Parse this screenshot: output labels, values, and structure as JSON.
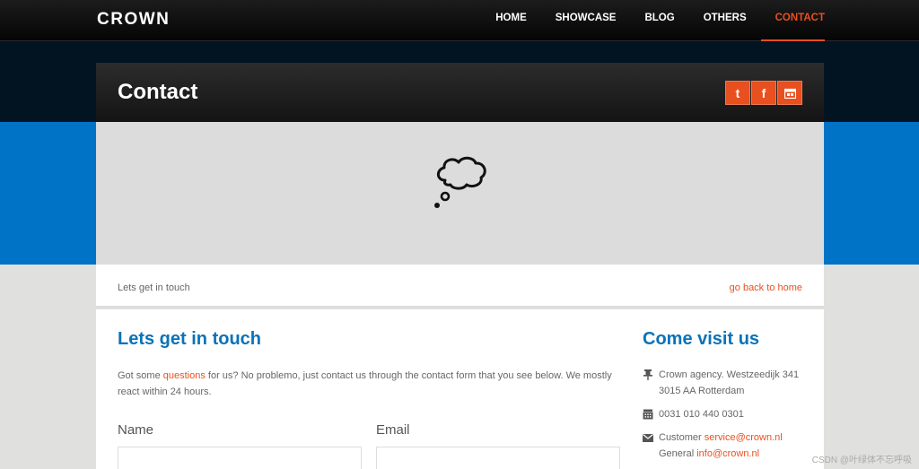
{
  "header": {
    "logo": "CROWN",
    "nav": [
      {
        "label": "HOME"
      },
      {
        "label": "SHOWCASE"
      },
      {
        "label": "BLOG"
      },
      {
        "label": "OTHERS"
      },
      {
        "label": "CONTACT",
        "active": true
      }
    ]
  },
  "title_bar": {
    "title": "Contact",
    "social": [
      {
        "icon": "twitter-icon",
        "glyph": "t"
      },
      {
        "icon": "facebook-icon",
        "glyph": "f"
      },
      {
        "icon": "calendar-icon",
        "glyph": "▣"
      }
    ]
  },
  "hero": {
    "icon": "thought-bubble-icon"
  },
  "breadcrumb": {
    "current": "Lets get in touch",
    "back_link": "go back to home"
  },
  "contact": {
    "heading": "Lets get in touch",
    "intro_before": "Got some ",
    "intro_link": "questions",
    "intro_after": " for us? No problemo, just contact us through the contact form that you see below. We mostly react within 24 hours.",
    "name_label": "Name",
    "email_label": "Email"
  },
  "visit": {
    "heading": "Come visit us",
    "address_line1": "Crown agency. Westzeedijk 341",
    "address_line2": "3015 AA Rotterdam",
    "phone": "0031 010 440 0301",
    "customer_label": "Customer ",
    "customer_email": "service@crown.nl",
    "general_label": "General ",
    "general_email": "info@crown.nl"
  },
  "watermark": "CSDN @叶绿体不忘呼吸",
  "colors": {
    "accent": "#e8501f",
    "heading_blue": "#0a72b8",
    "band_blue": "#0073c6",
    "band_dark": "#021421"
  }
}
